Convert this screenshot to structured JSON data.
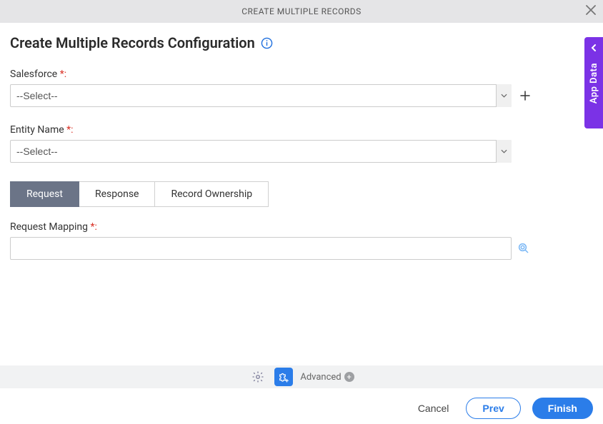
{
  "header": {
    "title": "CREATE MULTIPLE RECORDS"
  },
  "page": {
    "title": "Create Multiple Records Configuration"
  },
  "fields": {
    "salesforce": {
      "label": "Salesforce",
      "required_suffix": "*:",
      "placeholder": "--Select--"
    },
    "entity": {
      "label": "Entity Name",
      "required_suffix": "*:",
      "placeholder": "--Select--"
    },
    "request_mapping": {
      "label": "Request Mapping",
      "required_suffix": "*:"
    }
  },
  "tabs": {
    "request": "Request",
    "response": "Response",
    "ownership": "Record Ownership"
  },
  "toolbar": {
    "advanced": "Advanced"
  },
  "footer": {
    "cancel": "Cancel",
    "prev": "Prev",
    "finish": "Finish"
  },
  "side": {
    "label": "App Data"
  }
}
